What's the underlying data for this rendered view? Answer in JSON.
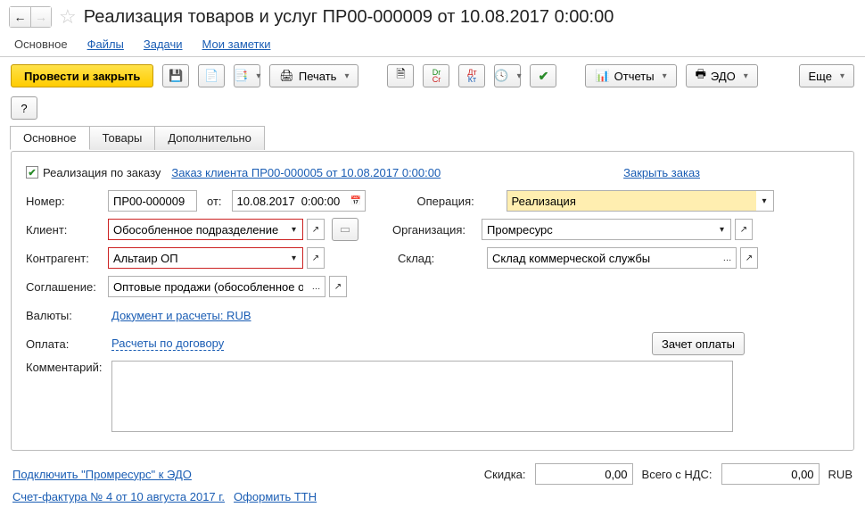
{
  "header": {
    "title": "Реализация товаров и услуг ПР00-000009 от 10.08.2017 0:00:00"
  },
  "topTabs": {
    "main": "Основное",
    "files": "Файлы",
    "tasks": "Задачи",
    "notes": "Мои заметки"
  },
  "toolbar": {
    "post_close": "Провести и закрыть",
    "print": "Печать",
    "reports": "Отчеты",
    "edo": "ЭДО",
    "more": "Еще"
  },
  "subtabs": {
    "main": "Основное",
    "goods": "Товары",
    "extra": "Дополнительно"
  },
  "form": {
    "by_order_label": "Реализация по заказу",
    "order_link": "Заказ клиента ПР00-000005 от 10.08.2017 0:00:00",
    "close_order": "Закрыть заказ",
    "num_label": "Номер:",
    "num_value": "ПР00-000009",
    "from_label": "от:",
    "date_value": "10.08.2017  0:00:00",
    "client_label": "Клиент:",
    "client_value": "Обособленное подразделение Ал",
    "contr_label": "Контрагент:",
    "contr_value": "Альтаир ОП",
    "agree_label": "Соглашение:",
    "agree_value": "Оптовые продажи (обособленное обесп",
    "curr_label": "Валюты:",
    "curr_link": "Документ и расчеты: RUB",
    "pay_label": "Оплата:",
    "pay_link": "Расчеты по договору",
    "pay_offset": "Зачет оплаты",
    "comment_label": "Комментарий:",
    "op_label": "Операция:",
    "op_value": "Реализация",
    "org_label": "Организация:",
    "org_value": "Промресурс",
    "wh_label": "Склад:",
    "wh_value": "Склад коммерческой службы"
  },
  "footer": {
    "connect_edo": "Подключить \"Промресурс\" к ЭДО",
    "discount_label": "Скидка:",
    "discount_value": "0,00",
    "total_label": "Всего с НДС:",
    "total_value": "0,00",
    "currency": "RUB",
    "invoice": "Счет-фактура № 4 от 10 августа 2017 г.",
    "ttn": "Оформить ТТН"
  }
}
